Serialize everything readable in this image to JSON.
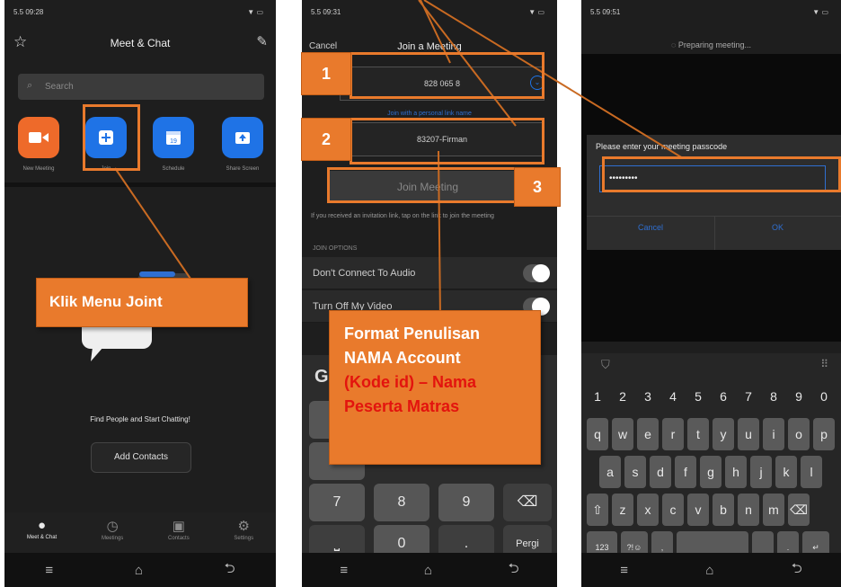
{
  "panel1": {
    "status_time": "5.5 09:28",
    "status_right": "▼ ▭",
    "title": "Meet & Chat",
    "search_placeholder": "Search",
    "tiles": [
      {
        "label": "New Meeting",
        "color": "#ee6a2a",
        "icon": "video-camera-icon",
        "glyph": "■"
      },
      {
        "label": "Join",
        "color": "#1f73e6",
        "icon": "plus-square-icon",
        "glyph": "+"
      },
      {
        "label": "Schedule",
        "color": "#1f73e6",
        "icon": "calendar-icon",
        "glyph": "19"
      },
      {
        "label": "Share Screen",
        "color": "#1f73e6",
        "icon": "share-up-icon",
        "glyph": "↑"
      }
    ],
    "empty_text": "Find People and Start Chatting!",
    "add_contacts": "Add Contacts",
    "tabs": [
      {
        "label": "Meet & Chat",
        "icon": "chat-bubble-icon",
        "glyph": "●"
      },
      {
        "label": "Meetings",
        "icon": "clock-icon",
        "glyph": "◷"
      },
      {
        "label": "Contacts",
        "icon": "contacts-icon",
        "glyph": "▣"
      },
      {
        "label": "Settings",
        "icon": "gear-icon",
        "glyph": "⚙"
      }
    ]
  },
  "panel2": {
    "status_time": "5.5 09:31",
    "status_right": "▼ ▭",
    "cancel": "Cancel",
    "title": "Join a Meeting",
    "meeting_id": "828 065 8",
    "link_text": "Join with a personal link name",
    "name_value": "83207-Firman",
    "join_button": "Join Meeting",
    "hint": "If you received an invitation link, tap on the link to join the meeting",
    "options_header": "JOIN OPTIONS",
    "opt1": "Don't Connect To Audio",
    "opt2": "Turn Off My Video",
    "keys_row1": [
      "7",
      "8",
      "9",
      "⌫"
    ],
    "keys_row2": [
      "⎵",
      "0",
      ".",
      "Pergi"
    ]
  },
  "panel3": {
    "status_time": "5.5 09:51",
    "status_right": "▼ ▭",
    "preparing": "Preparing meeting...",
    "dialog_title": "Please enter your meeting passcode",
    "passcode": "•••••••••",
    "cancel": "Cancel",
    "ok": "OK",
    "num_row": [
      "1",
      "2",
      "3",
      "4",
      "5",
      "6",
      "7",
      "8",
      "9",
      "0"
    ],
    "row1": [
      "q",
      "w",
      "e",
      "r",
      "t",
      "y",
      "u",
      "i",
      "o",
      "p"
    ],
    "row2": [
      "a",
      "s",
      "d",
      "f",
      "g",
      "h",
      "j",
      "k",
      "l"
    ],
    "row3": [
      "⇧",
      "z",
      "x",
      "c",
      "v",
      "b",
      "n",
      "m",
      "⌫"
    ],
    "bottom": [
      "123",
      "?!☺",
      ",",
      "",
      "",
      ".",
      "↵"
    ]
  },
  "nav": [
    "≡",
    "⌂",
    "⮌"
  ],
  "callouts": {
    "step1": "1",
    "step2": "2",
    "step3": "3",
    "klik": "Klik Menu Joint",
    "format_line1": "Format Penulisan",
    "format_line2": "NAMA Account",
    "format_line3": "(Kode id) – Nama",
    "format_line4": "Peserta Matras"
  },
  "colors": {
    "accent": "#e97a2c",
    "blue": "#1f73e6",
    "red_text": "#e3140e"
  }
}
